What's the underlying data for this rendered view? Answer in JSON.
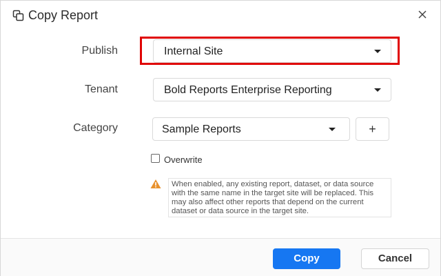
{
  "dialog": {
    "title": "Copy Report",
    "title_icon": "copy-icon",
    "close_icon": "close-icon"
  },
  "form": {
    "publish": {
      "label": "Publish",
      "value": "Internal Site"
    },
    "tenant": {
      "label": "Tenant",
      "value": "Bold Reports Enterprise Reporting"
    },
    "category": {
      "label": "Category",
      "value": "Sample Reports",
      "add_label": "+"
    },
    "overwrite": {
      "label": "Overwrite",
      "checked": false
    },
    "warning": {
      "icon": "warning-icon",
      "color": "#e8912d",
      "text": "When enabled, any existing report, dataset, or data source with the same name in the target site will be replaced. This may also affect other reports that depend on the current dataset or data source in the target site."
    }
  },
  "footer": {
    "copy_label": "Copy",
    "cancel_label": "Cancel"
  },
  "colors": {
    "primary": "#1677f2",
    "highlight": "#e00000"
  }
}
